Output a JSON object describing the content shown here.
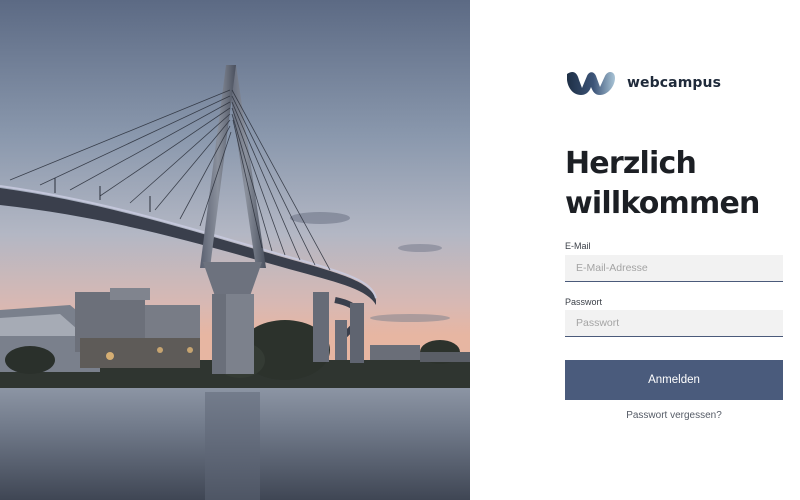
{
  "brand": {
    "name": "webcampus",
    "logo_icon": "webcampus-logo-icon",
    "colors": {
      "dark": "#1e2f45",
      "mid": "#3c5478",
      "light": "#9bb7cc"
    }
  },
  "hero": {
    "image": "harbor-bridge-dusk-photo"
  },
  "login": {
    "title_line1": "Herzlich",
    "title_line2": "willkommen",
    "email_label": "E-Mail",
    "email_placeholder": "E-Mail-Adresse",
    "email_value": "",
    "password_label": "Passwort",
    "password_placeholder": "Passwort",
    "password_value": "",
    "submit_label": "Anmelden",
    "forgot_label": "Passwort vergessen?",
    "accent_color": "#4a5b7c"
  }
}
